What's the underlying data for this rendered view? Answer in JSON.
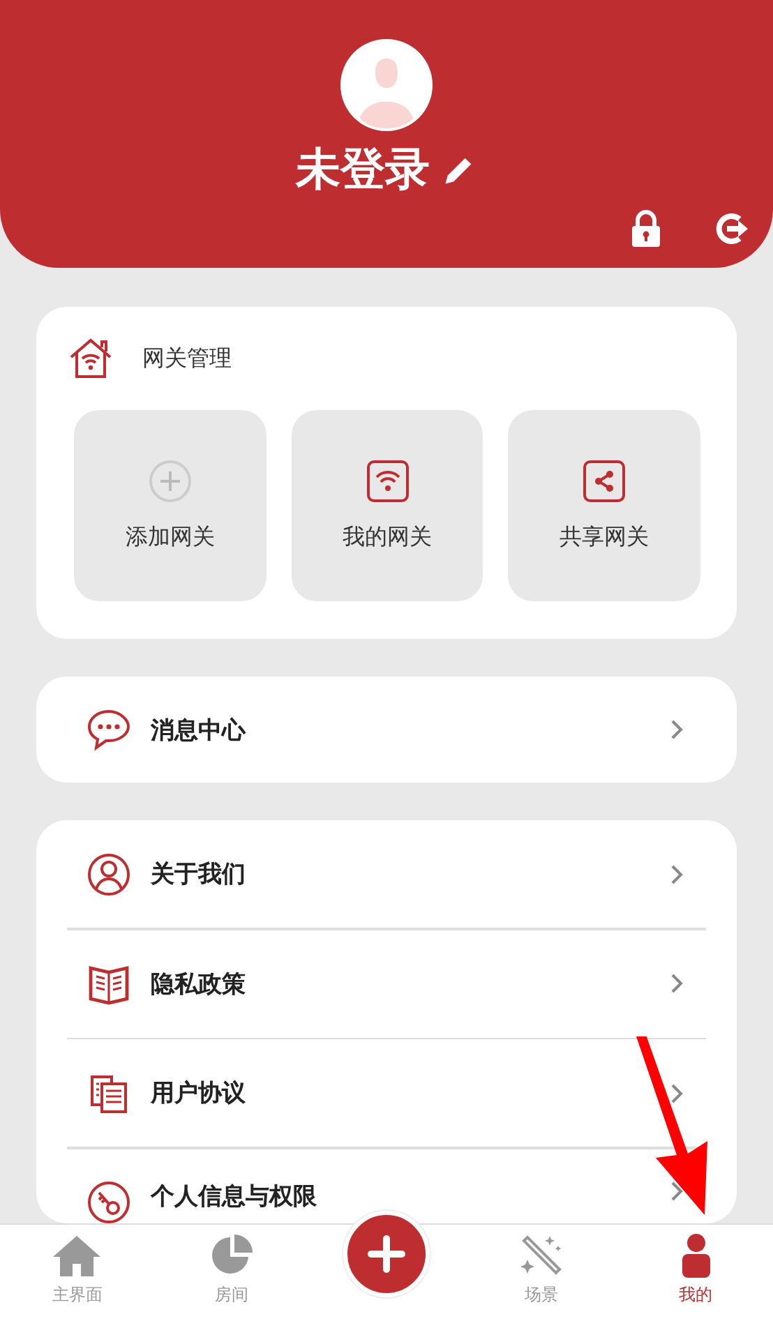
{
  "profile": {
    "name": "未登录"
  },
  "gateway": {
    "title": "网关管理",
    "actions": [
      {
        "label": "添加网关",
        "kind": "add"
      },
      {
        "label": "我的网关",
        "kind": "wifi"
      },
      {
        "label": "共享网关",
        "kind": "share"
      }
    ]
  },
  "message_center": {
    "label": "消息中心"
  },
  "menu": [
    {
      "label": "关于我们",
      "kind": "person"
    },
    {
      "label": "隐私政策",
      "kind": "book"
    },
    {
      "label": "用户协议",
      "kind": "docs"
    },
    {
      "label": "个人信息与权限",
      "kind": "key"
    }
  ],
  "tabs": [
    {
      "label": "主界面",
      "kind": "home",
      "selected": false
    },
    {
      "label": "房间",
      "kind": "pie",
      "selected": false
    },
    {
      "label": "场景",
      "kind": "wand",
      "selected": false
    },
    {
      "label": "我的",
      "kind": "me",
      "selected": true
    }
  ]
}
